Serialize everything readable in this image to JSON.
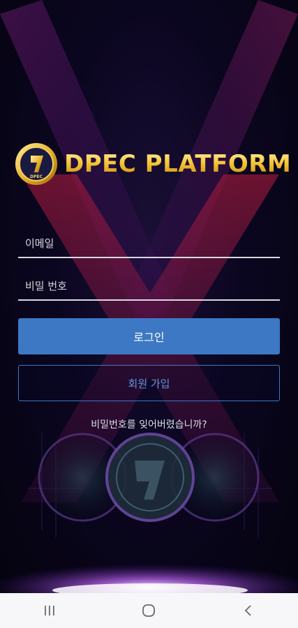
{
  "brand": {
    "name": "DPEC PLATFORM",
    "coin_text": "DPEC",
    "gold": "#f5c63a"
  },
  "login_form": {
    "email_placeholder": "이메일",
    "password_placeholder": "비밀 번호",
    "login_label": "로그인",
    "signup_label": "회원 가입",
    "forgot_password": "비밀번호를 잊어버렸습니까?",
    "accent_color": "#3c78c4"
  },
  "system_nav": {
    "recents_icon": "recents-icon",
    "home_icon": "home-icon",
    "back_icon": "back-icon"
  }
}
